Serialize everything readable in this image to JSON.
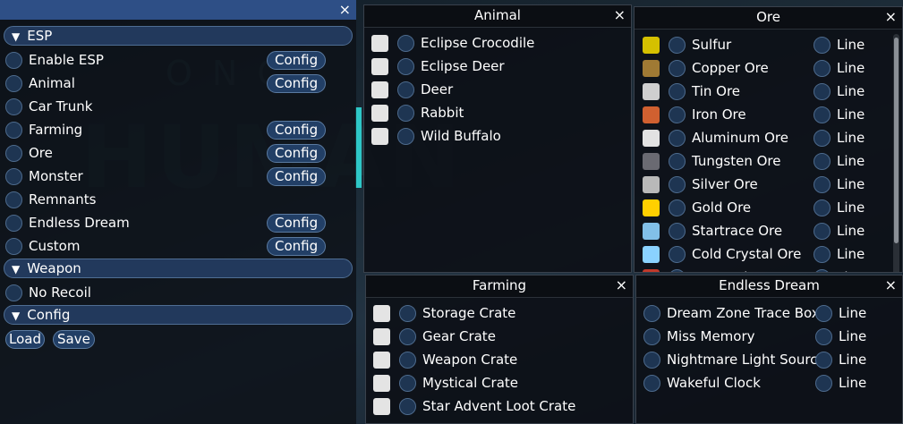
{
  "main": {
    "close": "×",
    "sections": [
      {
        "label": "ESP",
        "arrow": "▼"
      },
      {
        "label": "Weapon",
        "arrow": "▼"
      },
      {
        "label": "Config",
        "arrow": "▼"
      }
    ],
    "esp_items": [
      {
        "label": "Enable ESP",
        "config": "Config"
      },
      {
        "label": "Animal",
        "config": "Config"
      },
      {
        "label": "Car Trunk",
        "config": ""
      },
      {
        "label": "Farming",
        "config": "Config"
      },
      {
        "label": "Ore",
        "config": "Config"
      },
      {
        "label": "Monster",
        "config": "Config"
      },
      {
        "label": "Remnants",
        "config": ""
      },
      {
        "label": "Endless Dream",
        "config": "Config"
      },
      {
        "label": "Custom",
        "config": "Config"
      }
    ],
    "weapon_items": [
      "No Recoil"
    ],
    "config_buttons": {
      "load": "Load",
      "save": "Save"
    }
  },
  "background_text": {
    "line1": "ONC",
    "line2": "HUMAN"
  },
  "animal": {
    "title": "Animal",
    "close": "×",
    "items": [
      "Eclipse Crocodile",
      "Eclipse Deer",
      "Deer",
      "Rabbit",
      "Wild Buffalo"
    ]
  },
  "ore": {
    "title": "Ore",
    "close": "×",
    "line_label": "Line",
    "items": [
      {
        "label": "Sulfur",
        "color": "#d4c000"
      },
      {
        "label": "Copper Ore",
        "color": "#a07a34"
      },
      {
        "label": "Tin Ore",
        "color": "#cfcfcf"
      },
      {
        "label": "Iron Ore",
        "color": "#d06030"
      },
      {
        "label": "Aluminum Ore",
        "color": "#e2e2e2"
      },
      {
        "label": "Tungsten Ore",
        "color": "#6a6a72"
      },
      {
        "label": "Silver Ore",
        "color": "#b9b9b9"
      },
      {
        "label": "Gold Ore",
        "color": "#ffd000"
      },
      {
        "label": "Startrace Ore",
        "color": "#82c0e8"
      },
      {
        "label": "Cold Crystal Ore",
        "color": "#8ad2ff"
      },
      {
        "label": "Hot Rock Ore",
        "color": "#c0392b"
      }
    ]
  },
  "farming": {
    "title": "Farming",
    "close": "×",
    "items": [
      "Storage Crate",
      "Gear Crate",
      "Weapon Crate",
      "Mystical Crate",
      "Star Advent Loot Crate"
    ]
  },
  "endless_dream": {
    "title": "Endless Dream",
    "close": "×",
    "line_label": "Line",
    "items": [
      "Dream Zone Trace Box",
      "Miss Memory",
      "Nightmare Light Source",
      "Wakeful Clock"
    ]
  }
}
